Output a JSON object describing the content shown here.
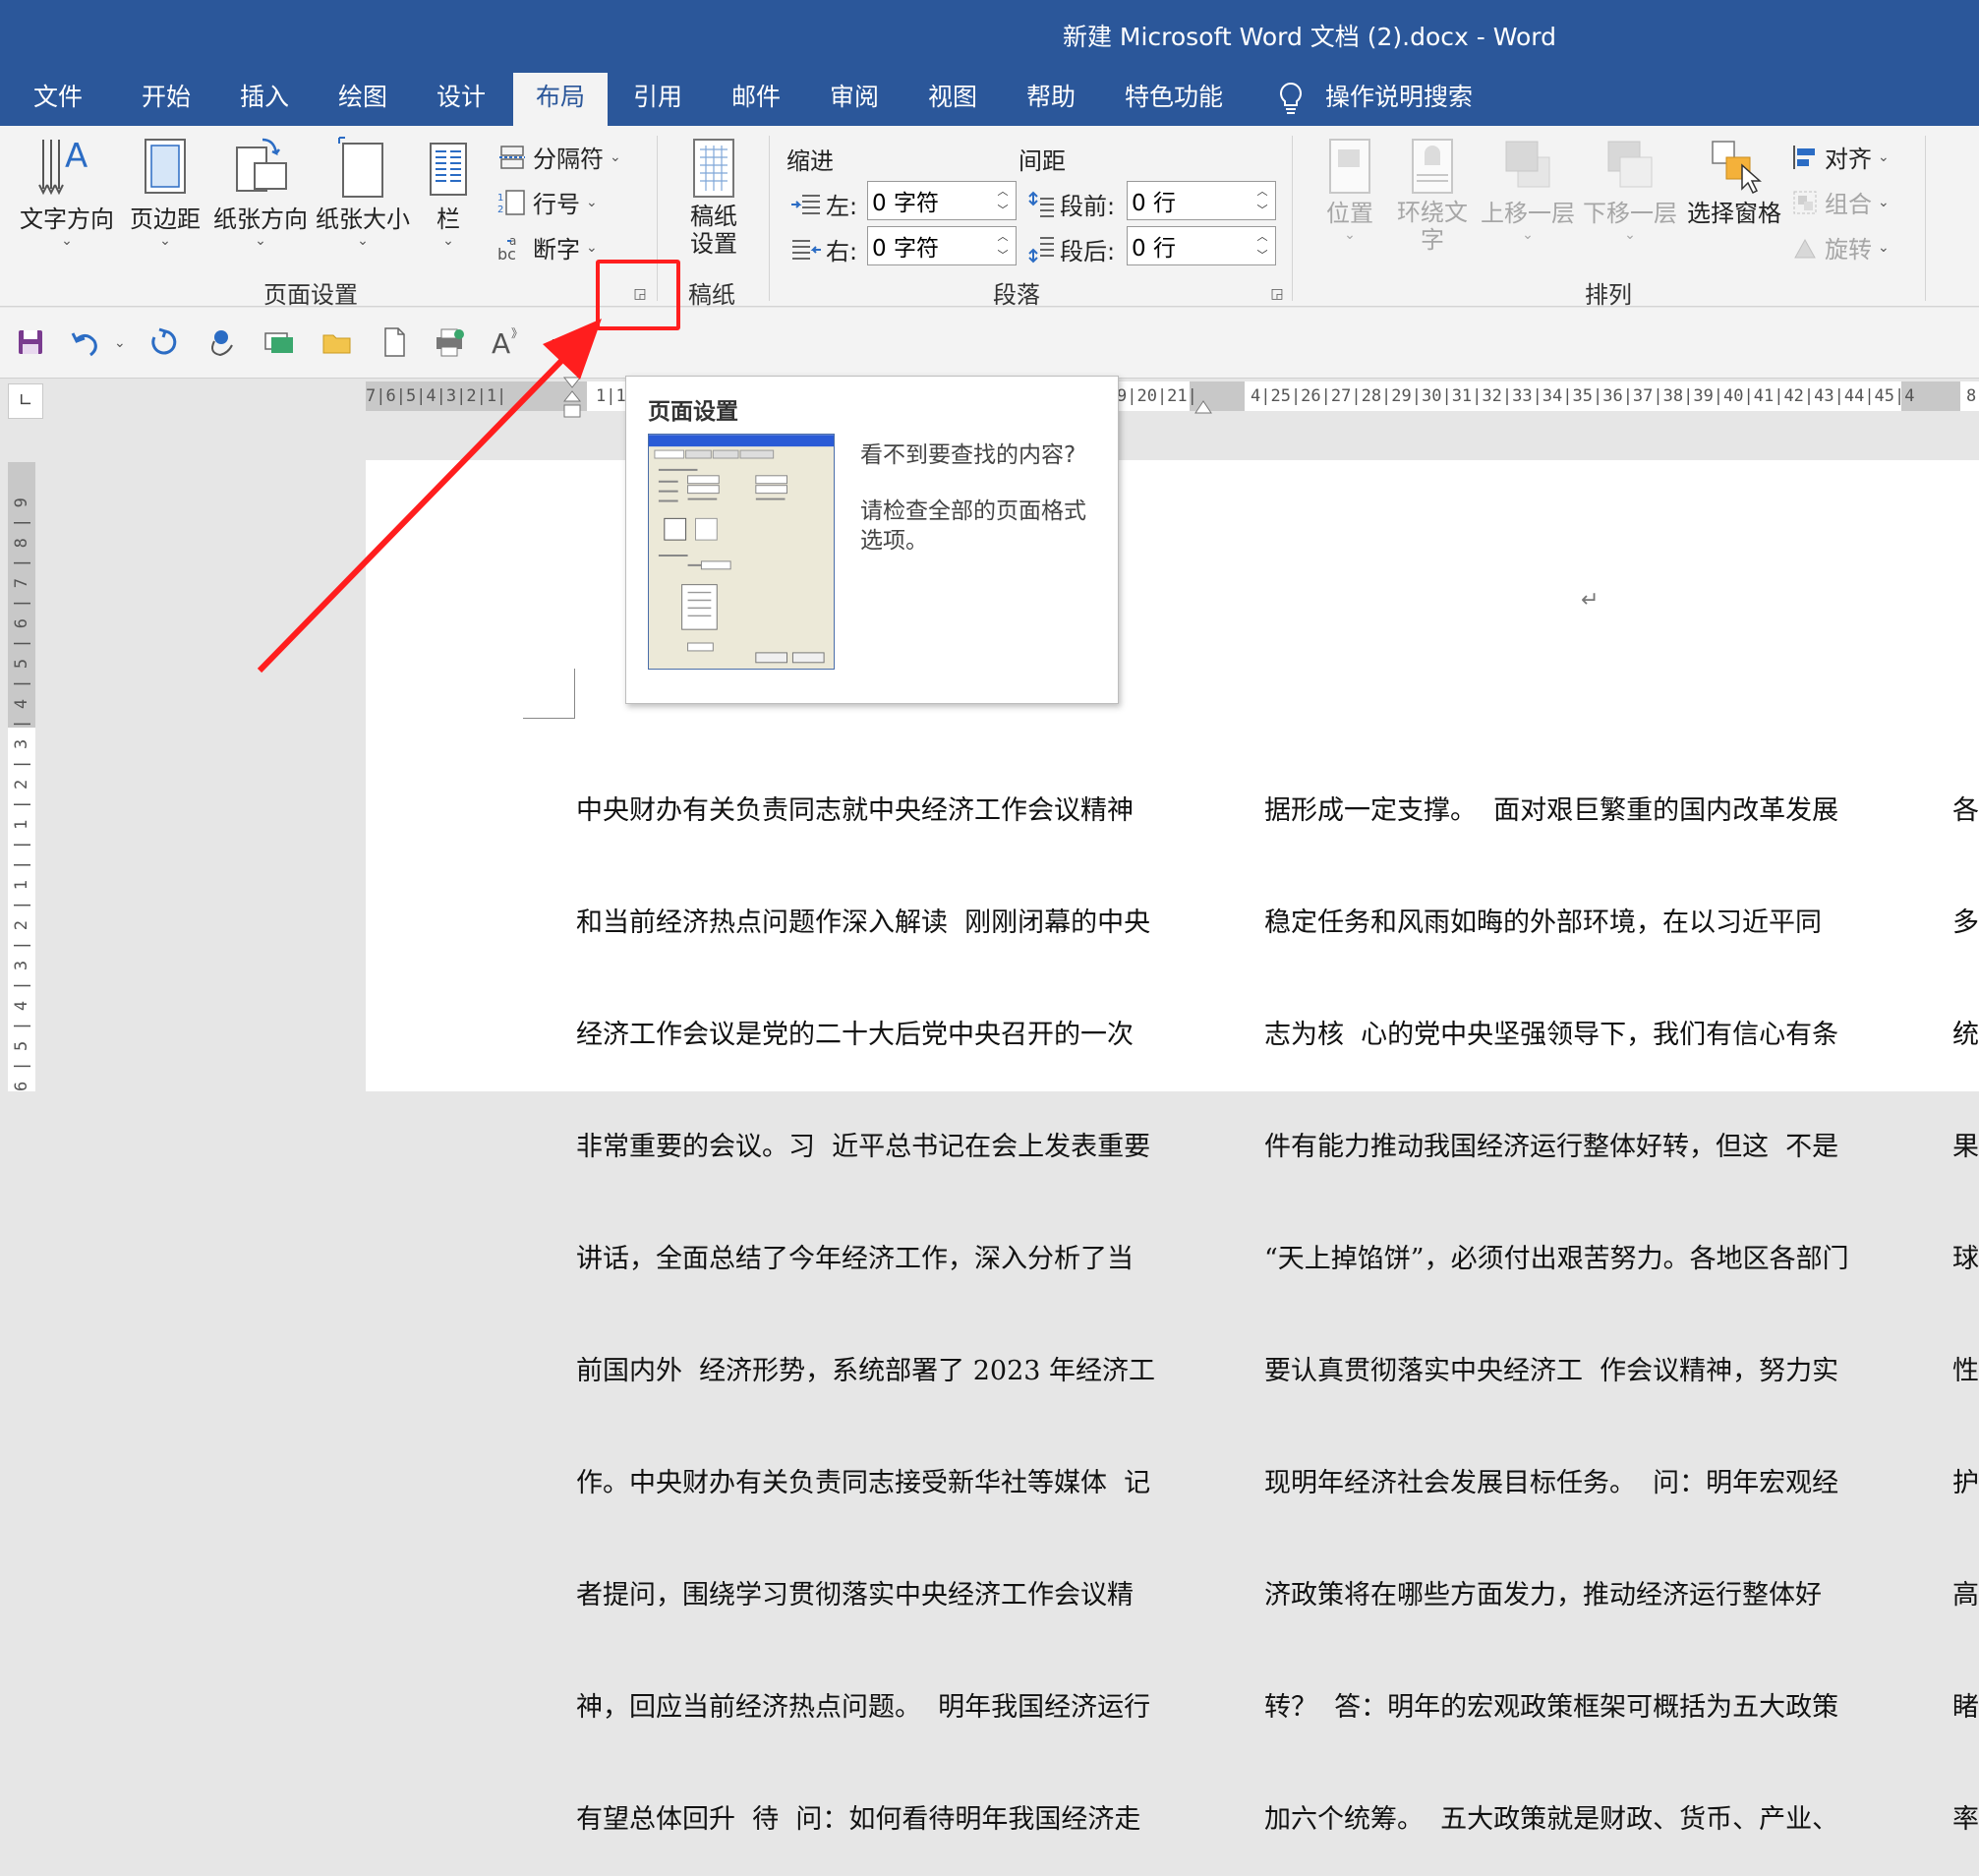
{
  "window": {
    "title": "新建 Microsoft Word 文档 (2).docx  -  Word"
  },
  "tabs": [
    {
      "label": "文件"
    },
    {
      "label": "开始"
    },
    {
      "label": "插入"
    },
    {
      "label": "绘图"
    },
    {
      "label": "设计"
    },
    {
      "label": "布局",
      "active": true
    },
    {
      "label": "引用"
    },
    {
      "label": "邮件"
    },
    {
      "label": "审阅"
    },
    {
      "label": "视图"
    },
    {
      "label": "帮助"
    },
    {
      "label": "特色功能"
    }
  ],
  "tell_me": {
    "label": "操作说明搜索",
    "icon": "lightbulb-icon"
  },
  "ribbon": {
    "page_setup": {
      "group_label": "页面设置",
      "text_direction": "文字方向",
      "margins": "页边距",
      "orientation": "纸张方向",
      "size": "纸张大小",
      "columns": "栏",
      "breaks": "分隔符",
      "line_numbers": "行号",
      "hyphenation": "断字"
    },
    "manuscript": {
      "group_label": "稿纸",
      "button_line1": "稿纸",
      "button_line2": "设置"
    },
    "paragraph": {
      "group_label": "段落",
      "indent_header": "缩进",
      "spacing_header": "间距",
      "left_label": "左:",
      "right_label": "右:",
      "before_label": "段前:",
      "after_label": "段后:",
      "left_value": "0 字符",
      "right_value": "0 字符",
      "before_value": "0 行",
      "after_value": "0 行"
    },
    "arrange": {
      "group_label": "排列",
      "position": "位置",
      "wrap_text_line1": "环绕文",
      "wrap_text_line2": "字",
      "bring_forward": "上移一层",
      "send_backward": "下移一层",
      "selection_pane": "选择窗格",
      "align": "对齐",
      "group": "组合",
      "rotate": "旋转"
    }
  },
  "ruler": {
    "horizontal_left": "7|6|5|4|3|2|1|",
    "horizontal_mid": "1|1",
    "horizontal_right_a": "9|20|21|",
    "horizontal_right_b": "4|25|26|27|28|29|30|31|32|33|34|35|36|37|38|39|40|41|42|43|44|45|4",
    "horizontal_end": "8",
    "vertical": "6 | 5 | 4 | 3 | 2 | 1 | | 1 | 2 | 3 | 4 | 5 | 6 | 7 | 8 | 9"
  },
  "tooltip": {
    "title": "页面设置",
    "line1": "看不到要查找的内容?",
    "line2": "请检查全部的页面格式选项。"
  },
  "document": {
    "column1": [
      "中央财办有关负责同志就中央经济工作会议精神",
      "和当前经济热点问题作深入解读  刚刚闭幕的中央",
      "经济工作会议是党的二十大后党中央召开的一次",
      "非常重要的会议。习  近平总书记在会上发表重要",
      "讲话，全面总结了今年经济工作，深入分析了当",
      "前国内外  经济形势，系统部署了 2023 年经济工",
      "作。中央财办有关负责同志接受新华社等媒体  记",
      "者提问，围绕学习贯彻落实中央经济工作会议精",
      "神，回应当前经济热点问题。  明年我国经济运行",
      "有望总体回升  待  问：如何看待明年我国经济走"
    ],
    "column2": [
      "据形成一定支撑。  面对艰巨繁重的国内改革发展",
      "稳定任务和风雨如晦的外部环境，在以习近平同",
      "志为核  心的党中央坚强领导下，我们有信心有条",
      "件有能力推动我国经济运行整体好转，但这  不是",
      "“天上掉馅饼”，必须付出艰苦努力。各地区各部门",
      "要认真贯彻落实中央经济工  作会议精神，努力实",
      "现明年经济社会发展目标任务。  问：明年宏观经",
      "济政策将在哪些方面发力，推动经济运行整体好",
      "转？  答：明年的宏观政策框架可概括为五大政策",
      "加六个统筹。  五大政策就是财政、货币、产业、"
    ],
    "column3": [
      "各",
      "多",
      "统",
      "果",
      "球",
      "性",
      "护",
      "高",
      "睹",
      "率"
    ]
  }
}
